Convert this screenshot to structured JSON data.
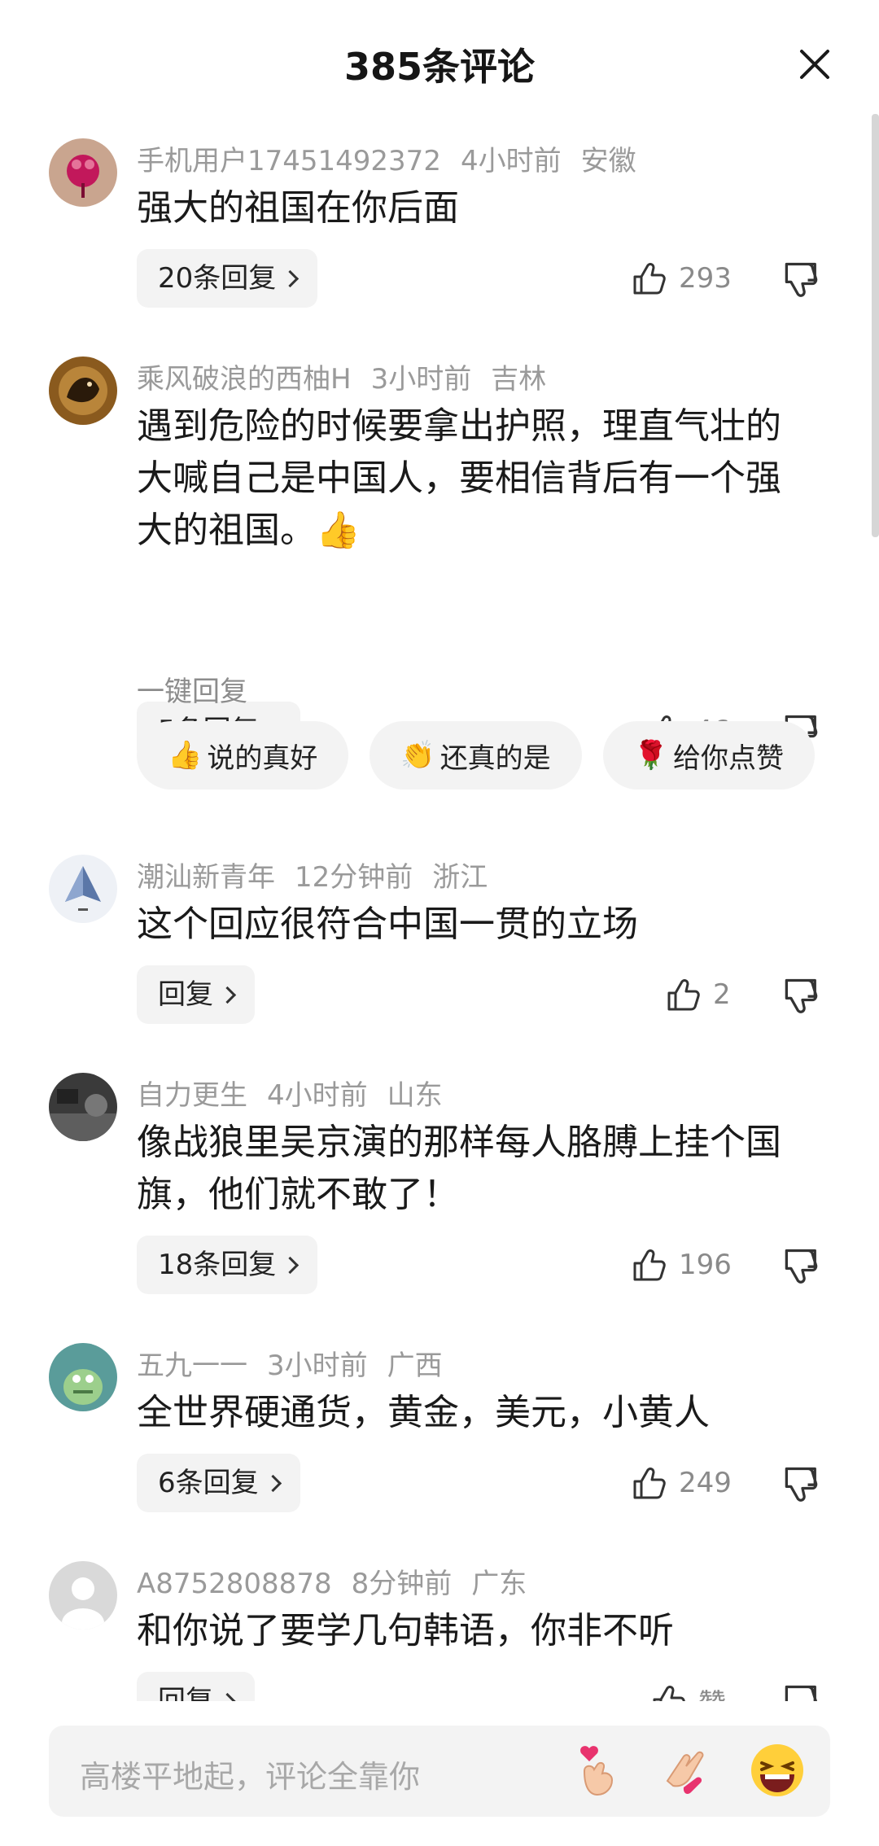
{
  "header": {
    "title": "385条评论"
  },
  "comments": [
    {
      "user": "手机用户17451492372",
      "time": "4小时前",
      "location": "安徽",
      "text": "强大的祖国在你后面",
      "reply_label": "20条回复",
      "likes": "293"
    },
    {
      "user": "乘风破浪的西柚H",
      "time": "3小时前",
      "location": "吉林",
      "text": "遇到危险的时候要拿出护照，理直气壮的大喊自己是中国人，要相信背后有一个强大的祖国。👍",
      "reply_label": "5条回复",
      "likes": "46",
      "quick_reply": {
        "label": "一键回复",
        "chips": [
          {
            "emoji": "👍",
            "text": "说的真好"
          },
          {
            "emoji": "👏",
            "text": "还真的是"
          },
          {
            "emoji": "🌹",
            "text": "给你点赞"
          }
        ]
      }
    },
    {
      "user": "潮汕新青年",
      "time": "12分钟前",
      "location": "浙江",
      "text": "这个回应很符合中国一贯的立场",
      "reply_label": "回复",
      "likes": "2"
    },
    {
      "user": "自力更生",
      "time": "4小时前",
      "location": "山东",
      "text": "像战狼里吴京演的那样每人胳膊上挂个国旗，他们就不敢了！",
      "reply_label": "18条回复",
      "likes": "196"
    },
    {
      "user": "五九一一",
      "time": "3小时前",
      "location": "广西",
      "text": "全世界硬通货，黄金，美元，小黄人",
      "reply_label": "6条回复",
      "likes": "249"
    },
    {
      "user": "A8752808878",
      "time": "8分钟前",
      "location": "广东",
      "text": "和你说了要学几句韩语，你非不听",
      "reply_label": "回复",
      "likes": "赞"
    }
  ],
  "input": {
    "placeholder": "高楼平地起，评论全靠你"
  },
  "icons": {
    "close": "close-icon",
    "like": "thumbs-up-icon",
    "dislike": "thumbs-down-icon",
    "emoji_buttons": [
      "finger-heart-emoji-icon",
      "clap-emoji-icon",
      "laughing-emoji-icon"
    ]
  },
  "colors": {
    "background": "#ffffff",
    "meta_text": "#9a9a9a",
    "chip_bg": "#f3f3f3"
  }
}
